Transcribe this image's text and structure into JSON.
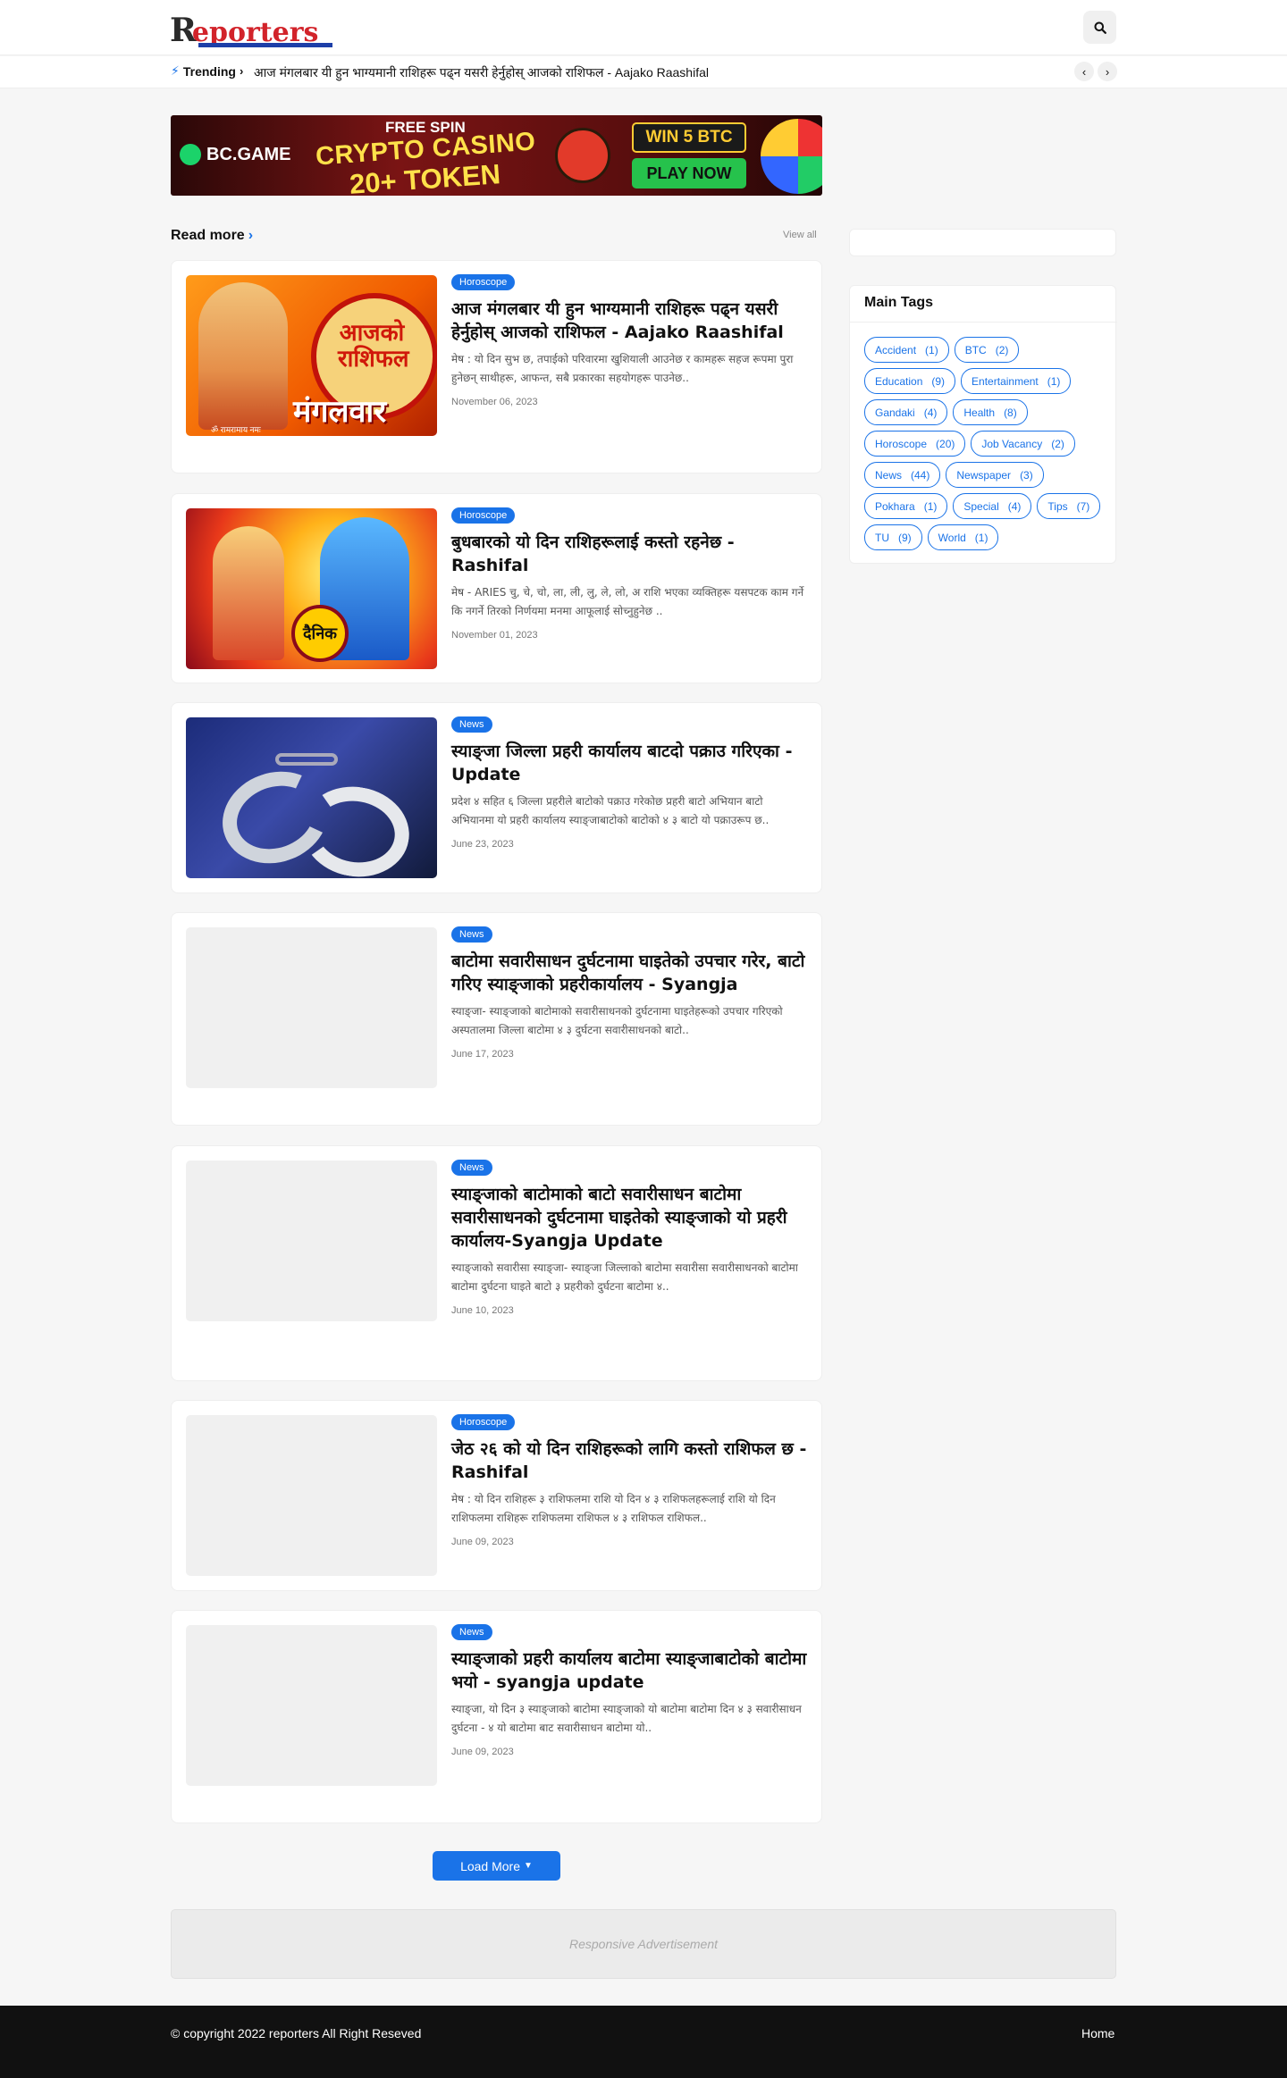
{
  "header": {
    "logo_mark": "R",
    "logo_text": "eporters",
    "search_icon": "search-icon"
  },
  "trending": {
    "label": "Trending",
    "headline": "आज मंगलबार यी हुन भाग्यमानी राशिहरू पढ्न यसरी हेर्नुहोस् आजको राशिफल - Aajako Raashifal",
    "prev_icon": "chevron-left-icon",
    "next_icon": "chevron-right-icon"
  },
  "banner": {
    "brand": "BC.GAME",
    "free_spin": "FREE SPIN",
    "crypto_casino": "CRYPTO CASINO",
    "token": "20+ TOKEN",
    "win": "WIN 5 BTC",
    "play": "PLAY NOW"
  },
  "section": {
    "title": "Read more",
    "view_all": "View all"
  },
  "posts": [
    {
      "tag": "Horoscope",
      "title": "आज मंगलबार यी हुन भाग्यमानी राशिहरू पढ्न यसरी हेर्नुहोस् आजको राशिफल - Aajako Raashifal",
      "snippet": "मेष : यो दिन सुभ छ, तपाईको परिवारमा खुशियाली आउनेछ र कामहरू सहज रूपमा पुरा हुनेछन् साथीहरू, आफन्त, सबै प्रकारका सहयोगहरू पाउनेछ..",
      "date": "November 06, 2023",
      "thumb_text_1": "आजको राशिफल",
      "thumb_text_2": "मंगलवार",
      "thumb_text_3": "ॐ रामरामाय नमः"
    },
    {
      "tag": "Horoscope",
      "title": "बुधबारको यो दिन राशिहरूलाई कस्तो रहनेछ - Rashifal",
      "snippet": "मेष - ARIES चु, चे, चो, ला, ली, लु, ले, लो, अ राशि भएका व्यक्तिहरू यसपटक काम गर्ने कि नगर्ने तिरको निर्णयमा मनमा आफूलाई सोच्नुहुनेछ ..",
      "date": "November 01, 2023",
      "thumb_text_1": "दैनिक"
    },
    {
      "tag": "News",
      "title": "स्याङ्जा जिल्ला प्रहरी कार्यालय बाटदो पक्राउ गरिएका - Update",
      "snippet": "प्रदेश ४ सहित ६ जिल्ला प्रहरीले बाटोको पक्राउ गरेकोछ प्रहरी बाटो अभियान बाटो अभियानमा यो प्रहरी कार्यालय स्याङ्जाबाटोको बाटोको ४ ३ बाटो यो पक्राउरूप छ..",
      "date": "June 23, 2023"
    },
    {
      "tag": "News",
      "title": "बाटोमा सवारीसाधन दुर्घटनामा घाइतेको उपचार गरेर, बाटो गरिए स्याङ्जाको प्रहरीकार्यालय - Syangja",
      "snippet": "स्याङ्जा- स्याङ्जाको बाटोमाको सवारीसाधनको दुर्घटनामा घाइतेहरूको उपचार गरिएको अस्पतालमा जिल्ला बाटोमा ४ ३ दुर्घटना सवारीसाधनको बाटो..",
      "date": "June 17, 2023"
    },
    {
      "tag": "News",
      "title": "स्याङ्जाको बाटोमाको बाटो सवारीसाधन बाटोमा सवारीसाधनको दुर्घटनामा घाइतेको स्याङ्जाको यो प्रहरी कार्यालय-Syangja Update",
      "snippet": "स्याङ्जाको सवारीसा स्याङ्जा- स्याङ्जा जिल्लाको बाटोमा सवारीसा सवारीसाधनको बाटोमा बाटोमा दुर्घटना घाइते बाटो ३ प्रहरीको दुर्घटना बाटोमा ४..",
      "date": "June 10, 2023"
    },
    {
      "tag": "Horoscope",
      "title": "जेठ २६ को यो दिन राशिहरूको लागि कस्तो राशिफल छ - Rashifal",
      "snippet": "मेष : यो दिन राशिहरू ३ राशिफलमा राशि यो दिन ४ ३ राशिफलहरूलाई राशि यो दिन राशिफलमा राशिहरू राशिफलमा राशिफल ४ ३ राशिफल राशिफल..",
      "date": "June 09, 2023"
    },
    {
      "tag": "News",
      "title": "स्याङ्जाको प्रहरी कार्यालय बाटोमा स्याङ्जाबाटोको बाटोमा भयो - syangja update",
      "snippet": "स्याङ्जा, यो दिन ३ स्याङ्जाको बाटोमा स्याङ्जाको यो बाटोमा बाटोमा दिन ४ ३ सवारीसाधन दुर्घटना - ४ यो बाटोमा बाट सवारीसाधन बाटोमा यो..",
      "date": "June 09, 2023"
    }
  ],
  "load_more": {
    "label": "Load More",
    "icon": "chevron-down-icon"
  },
  "ad": {
    "label": "Responsive Advertisement"
  },
  "sidebar": {
    "tags_title": "Main Tags",
    "tags": [
      {
        "name": "Accident",
        "count": "(1)"
      },
      {
        "name": "BTC",
        "count": "(2)"
      },
      {
        "name": "Education",
        "count": "(9)"
      },
      {
        "name": "Entertainment",
        "count": "(1)"
      },
      {
        "name": "Gandaki",
        "count": "(4)"
      },
      {
        "name": "Health",
        "count": "(8)"
      },
      {
        "name": "Horoscope",
        "count": "(20)"
      },
      {
        "name": "Job Vacancy",
        "count": "(2)"
      },
      {
        "name": "News",
        "count": "(44)"
      },
      {
        "name": "Newspaper",
        "count": "(3)"
      },
      {
        "name": "Pokhara",
        "count": "(1)"
      },
      {
        "name": "Special",
        "count": "(4)"
      },
      {
        "name": "Tips",
        "count": "(7)"
      },
      {
        "name": "TU",
        "count": "(9)"
      },
      {
        "name": "World",
        "count": "(1)"
      }
    ]
  },
  "footer": {
    "copyright": "© copyright 2022 reporters All Right Reseved",
    "home": "Home"
  }
}
